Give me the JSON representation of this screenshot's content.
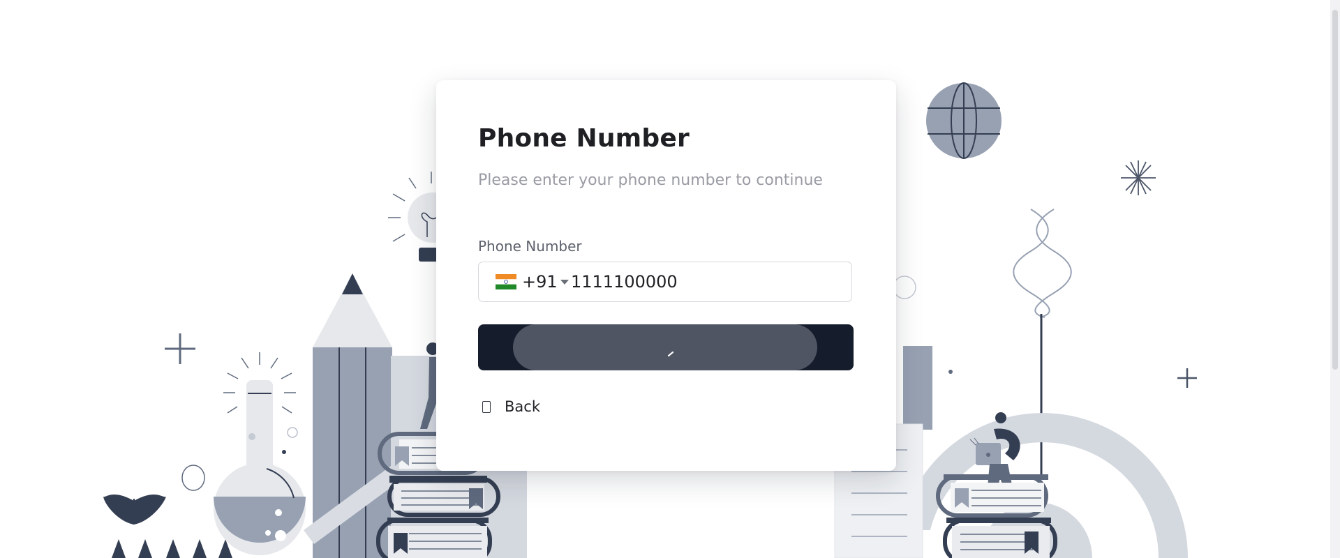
{
  "login": {
    "title": "Phone Number",
    "subtitle": "Please enter your phone number to continue",
    "phone_label": "Phone Number",
    "country": {
      "dial_code": "+91",
      "flag_icon": "india-flag-icon"
    },
    "phone_value": "1111100000",
    "submit_state": "loading",
    "back_label": "Back",
    "back_icon": "phone-outline-icon"
  },
  "colors": {
    "button": "#151c2b",
    "illustration_dark": "#343e52",
    "illustration_mid": "#97a1b2",
    "illustration_light": "#e6e8ec"
  }
}
